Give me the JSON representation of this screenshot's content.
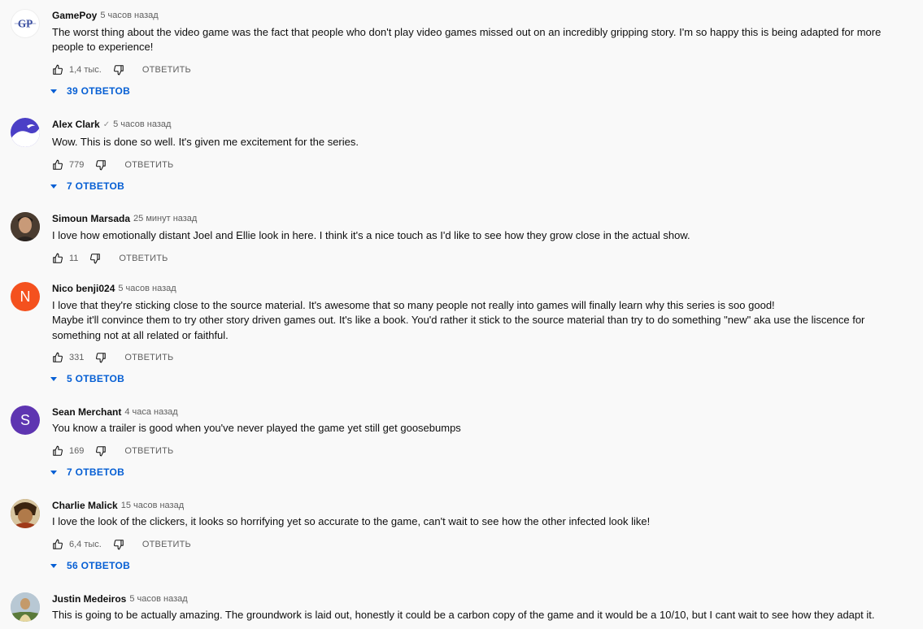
{
  "comments": [
    {
      "author": "GamePoy",
      "verified": false,
      "time": "5 часов назад",
      "avatar": {
        "type": "logo",
        "bg": "#ffffff",
        "letter": "GP",
        "color": "#3a4ea0"
      },
      "lines": [
        "The worst thing about the video game was the fact that people who don't play video games missed out on an incredibly gripping story. I'm so happy this is being adapted for more people to experience!"
      ],
      "likes": "1,4 тыс.",
      "reply_label": "ОТВЕТИТЬ",
      "replies": "39 ОТВЕТОВ"
    },
    {
      "author": "Alex Clark",
      "verified": true,
      "verified_mark": "✓",
      "time": "5 часов назад",
      "avatar": {
        "type": "graphic",
        "bg": "#4b3fc6",
        "letter": "",
        "color": "#ffffff"
      },
      "lines": [
        "Wow. This is done so well. It's given me excitement for the series."
      ],
      "likes": "779",
      "reply_label": "ОТВЕТИТЬ",
      "replies": "7 ОТВЕТОВ"
    },
    {
      "author": "Simoun Marsada",
      "verified": false,
      "time": "25 минут назад",
      "avatar": {
        "type": "photo",
        "bg": "#5a4a3c",
        "letter": "",
        "color": "#ffffff"
      },
      "lines": [
        "I love how emotionally distant Joel and Ellie look in here. I think it's a nice touch as I'd like to see how they grow close in the actual show."
      ],
      "likes": "11",
      "reply_label": "ОТВЕТИТЬ",
      "replies": ""
    },
    {
      "author": "Nico benji024",
      "verified": false,
      "time": "5 часов назад",
      "avatar": {
        "type": "letter",
        "bg": "#f4511e",
        "letter": "N",
        "color": "#ffffff"
      },
      "lines": [
        "I love that they're sticking close to the source material. It's awesome that so many people not really into games will finally learn why this series is soo good!",
        "Maybe it'll convince them to try other story driven games out. It's like a book. You'd rather it stick to the source material than try to do something \"new\" aka use the liscence for something not at all related or faithful."
      ],
      "likes": "331",
      "reply_label": "ОТВЕТИТЬ",
      "replies": "5 ОТВЕТОВ"
    },
    {
      "author": "Sean Merchant",
      "verified": false,
      "time": "4 часа назад",
      "avatar": {
        "type": "letter",
        "bg": "#5e35b1",
        "letter": "S",
        "color": "#ffffff"
      },
      "lines": [
        "You know a trailer is good when you've never played the game yet still get goosebumps"
      ],
      "likes": "169",
      "reply_label": "ОТВЕТИТЬ",
      "replies": "7 ОТВЕТОВ"
    },
    {
      "author": "Charlie Malick",
      "verified": false,
      "time": "15 часов назад",
      "avatar": {
        "type": "photo",
        "bg": "#8a5a2a",
        "letter": "",
        "color": "#ffffff"
      },
      "lines": [
        "I love the look of the clickers, it looks so horrifying yet so accurate to the game, can't wait to see how the other infected look like!"
      ],
      "likes": "6,4 тыс.",
      "reply_label": "ОТВЕТИТЬ",
      "replies": "56 ОТВЕТОВ"
    },
    {
      "author": "Justin Medeiros",
      "verified": false,
      "time": "5 часов назад",
      "avatar": {
        "type": "photo",
        "bg": "#9bb0c0",
        "letter": "",
        "color": "#ffffff"
      },
      "lines": [
        "This is going to be actually amazing. The groundwork is laid out, honestly it could be a carbon copy of the game and it would be a 10/10, but I cant wait to see how they adapt it."
      ],
      "likes": "",
      "reply_label": "",
      "replies": ""
    }
  ]
}
